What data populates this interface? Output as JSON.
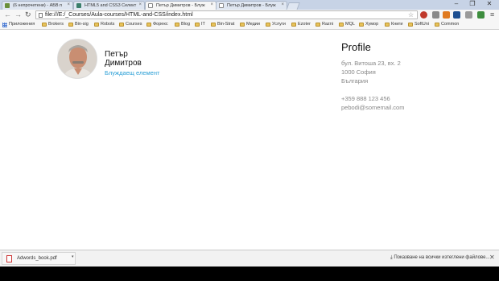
{
  "browser": {
    "tabs": [
      {
        "title": "(6 непрочетени) - АБВ п",
        "active": false
      },
      {
        "title": "HTML5 and CSS3 Селект",
        "active": false
      },
      {
        "title": "Петър Димитров - Блуж",
        "active": true
      },
      {
        "title": "Петър Димитров - Блуж",
        "active": false
      }
    ],
    "url": "file:///E:/_Courses/Aula-courses/HTML-and-CSS/index.html",
    "window_controls": {
      "minimize": "–",
      "restore": "❐",
      "close": "✕"
    },
    "bookmarks": [
      "Приложения",
      "Brokers",
      "Bin-sig",
      "Robots",
      "Courses",
      "Форекс",
      "Blog",
      "IT",
      "Bin-Strat",
      "Медии",
      "Услуги",
      "Ezoter",
      "Razni",
      "MQL",
      "Хумор",
      "Книги",
      "SoftUni",
      "Common"
    ]
  },
  "profile_card": {
    "first_name": "Петър",
    "last_name": "Димитров",
    "link_label": "Блуждаещ елемент"
  },
  "profile_info": {
    "title": "Profile",
    "address_line1": "бул. Витоша 23, вх. 2",
    "address_line2": "1000 София",
    "country": "България",
    "phone": "+359 888 123 456",
    "email": "pebodi@somemail.com"
  },
  "downloads": {
    "file_name": "Adwords_book.pdf",
    "show_all_label": "Показване на всички изтеглени файлове...",
    "close_label": "✕"
  },
  "colors": {
    "link": "#2a9fd6",
    "muted_text": "#888888"
  }
}
